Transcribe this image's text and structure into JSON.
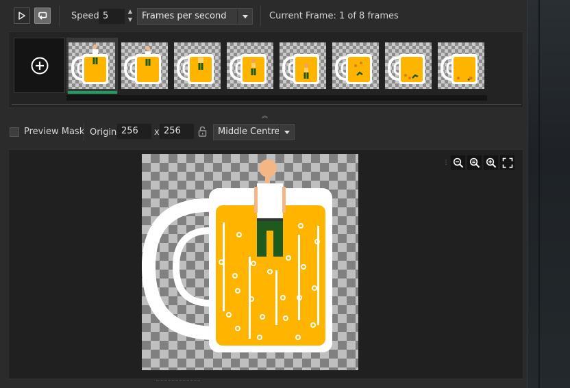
{
  "toolbar": {
    "speed_label": "Speed:",
    "speed_value": "5",
    "speed_unit": "Frames per second",
    "current_frame_text": "Current Frame: 1 of 8 frames"
  },
  "frames": {
    "count": 8,
    "selected_index": 0,
    "add_icon": "plus-circle-icon"
  },
  "options": {
    "preview_mask_label": "Preview Mask",
    "origin_label": "Origin:",
    "origin_x": "256",
    "origin_sep": "x",
    "origin_y": "256",
    "origin_mode": "Middle Centre"
  },
  "colors": {
    "beer": "#ffb400",
    "mug": "#ffffff",
    "skin": "#f4b684",
    "pants": "#1e5a1e",
    "selection": "#1e9e60"
  }
}
